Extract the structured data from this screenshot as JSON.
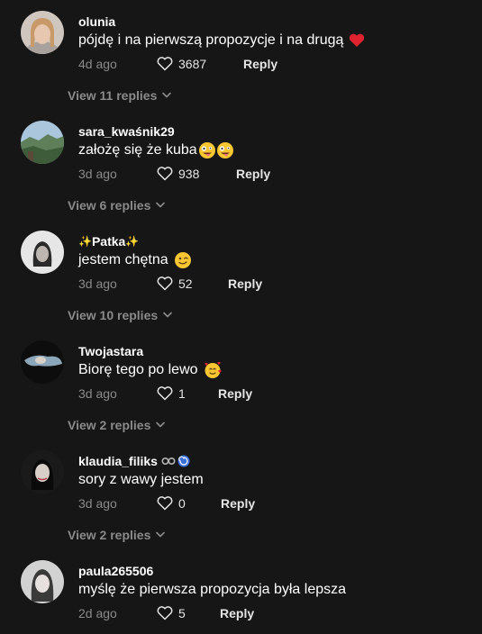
{
  "comments": [
    {
      "username": "olunia",
      "text": "pójdę i na pierwszą propozycje i na drugą",
      "emojis": [
        "red-heart"
      ],
      "time": "4d ago",
      "likes": "3687",
      "reply_label": "Reply",
      "view_replies": "View 11 replies"
    },
    {
      "username": "sara_kwaśnik29",
      "text": "założę się że kuba",
      "emojis": [
        "zany-face",
        "zany-face"
      ],
      "time": "3d ago",
      "likes": "938",
      "reply_label": "Reply",
      "view_replies": "View 6 replies"
    },
    {
      "username": "Patka",
      "username_decor": "✨",
      "text": "jestem chętna",
      "emojis": [
        "winking-face"
      ],
      "time": "3d ago",
      "likes": "52",
      "reply_label": "Reply",
      "view_replies": "View 10 replies"
    },
    {
      "username": "Twojastara",
      "text": "Biorę tego po lewo",
      "emojis": [
        "smiling-face-with-hearts"
      ],
      "time": "3d ago",
      "likes": "1",
      "reply_label": "Reply",
      "view_replies": "View 2 replies"
    },
    {
      "username": "klaudia_filiks",
      "username_icons": [
        "handcuffs-icon",
        "cyclone-icon"
      ],
      "text": "sory z wawy jestem",
      "emojis": [],
      "time": "3d ago",
      "likes": "0",
      "reply_label": "Reply",
      "view_replies": "View 2 replies"
    },
    {
      "username": "paula265506",
      "text": "myślę że pierwsza propozycja była lepsza",
      "emojis": [],
      "time": "2d ago",
      "likes": "5",
      "reply_label": "Reply",
      "view_replies": ""
    }
  ],
  "colors": {
    "background": "#161616",
    "primary_text": "#ffffff",
    "secondary_text": "#8a8a8a",
    "action_text": "#e5e5e5"
  }
}
